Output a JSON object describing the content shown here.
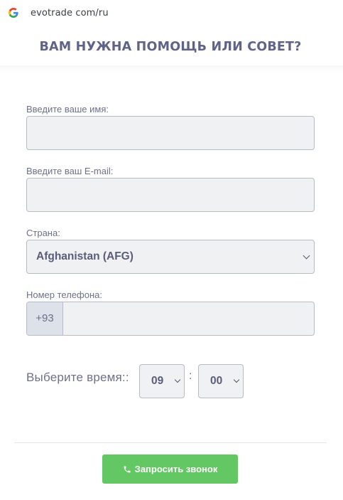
{
  "browser": {
    "url": "evotrade com/ru"
  },
  "header": {
    "title": "ВАМ НУЖНА ПОМОЩЬ ИЛИ СОВЕТ?"
  },
  "form": {
    "name": {
      "label": "Введите ваше имя:",
      "value": ""
    },
    "email": {
      "label": "Введите ваш E-mail:",
      "value": ""
    },
    "country": {
      "label": "Страна:",
      "selected": "Afghanistan (AFG)"
    },
    "phone": {
      "label": "Номер телефона:",
      "prefix": "+93",
      "value": ""
    },
    "time": {
      "label": "Выберите время::",
      "hour": "09",
      "minute": "00",
      "separator": ":"
    },
    "submit": {
      "label": "Запросить звонок"
    }
  },
  "colors": {
    "title": "#5f6389",
    "field_bg": "#f0f1f2",
    "button": "#63c763"
  }
}
